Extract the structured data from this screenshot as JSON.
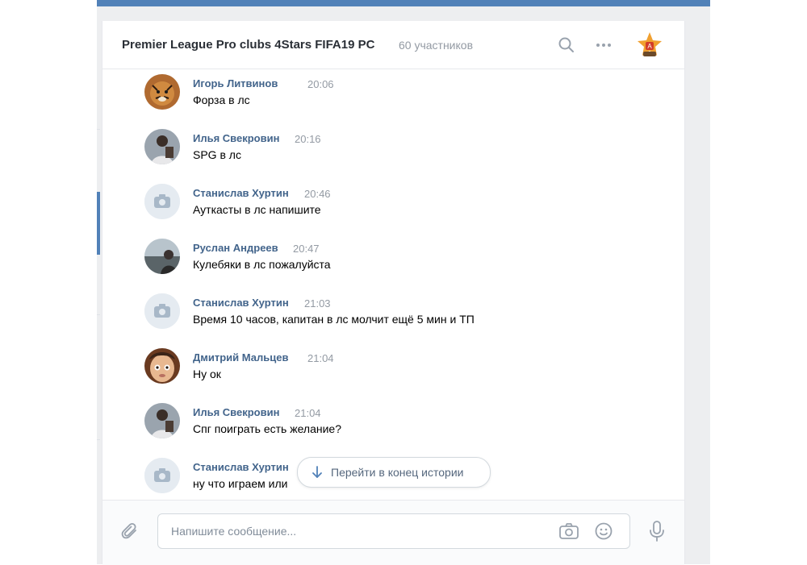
{
  "chat": {
    "title": "Premier League Pro clubs 4Stars FIFA19 PC",
    "members": "60 участников"
  },
  "messages": [
    {
      "author": "Игорь Литвинов",
      "time": "20:06",
      "text": "Форза в лс",
      "avatar": "tiger-avatar"
    },
    {
      "author": "Илья Свекровин",
      "time": "20:16",
      "text": "SPG в лс",
      "avatar": "person-avatar"
    },
    {
      "author": "Станислав Хуртин",
      "time": "20:46",
      "text": "Ауткасты в лс напишите",
      "avatar": "camera-placeholder"
    },
    {
      "author": "Руслан Андреев",
      "time": "20:47",
      "text": "Кулебяки в лс пожалуйста",
      "avatar": "person-avatar"
    },
    {
      "author": "Станислав Хуртин",
      "time": "21:03",
      "text": "Время 10 часов, капитан в лс молчит ещё 5 мин и ТП",
      "avatar": "camera-placeholder"
    },
    {
      "author": "Дмитрий Мальцев",
      "time": "21:04",
      "text": "Ну ок",
      "avatar": "face-avatar"
    },
    {
      "author": "Илья Свекровин",
      "time": "21:04",
      "text": "Спг поиграть есть желание?",
      "avatar": "person-avatar"
    },
    {
      "author": "Станислав Хуртин",
      "time": "",
      "text": "ну что играем или",
      "avatar": "camera-placeholder"
    }
  ],
  "jump_button": {
    "label": "Перейти в конец истории"
  },
  "composer": {
    "placeholder": "Напишите сообщение..."
  },
  "colors": {
    "accent": "#5181b8",
    "author": "#42648b",
    "muted": "#939aa3"
  }
}
